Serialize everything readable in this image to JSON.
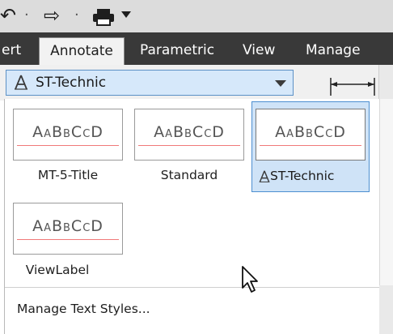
{
  "quick_access": {
    "icons": [
      "undo-icon",
      "redo-icon",
      "print-icon",
      "customize-dropdown-icon"
    ]
  },
  "ribbon": {
    "tabs": [
      {
        "label": "ert",
        "active": false
      },
      {
        "label": "Annotate",
        "active": true
      },
      {
        "label": "Parametric",
        "active": false
      },
      {
        "label": "View",
        "active": false
      },
      {
        "label": "Manage",
        "active": false
      }
    ]
  },
  "text_style_combo": {
    "value": "ST-Technic",
    "icon": "text-style-icon"
  },
  "gallery": {
    "sample_text": "AaBbCcD",
    "styles": [
      {
        "name": "MT-5-Title",
        "selected": false
      },
      {
        "name": "Standard",
        "selected": false
      },
      {
        "name": "ST-Technic",
        "selected": true
      },
      {
        "name": "ViewLabel",
        "selected": false
      }
    ],
    "manage_label": "Manage Text Styles..."
  },
  "colors": {
    "tab_bar": "#393939",
    "selection_fill": "#cfe3f7",
    "selection_border": "#4d8fd0",
    "baseline_red": "#f07a7a"
  }
}
